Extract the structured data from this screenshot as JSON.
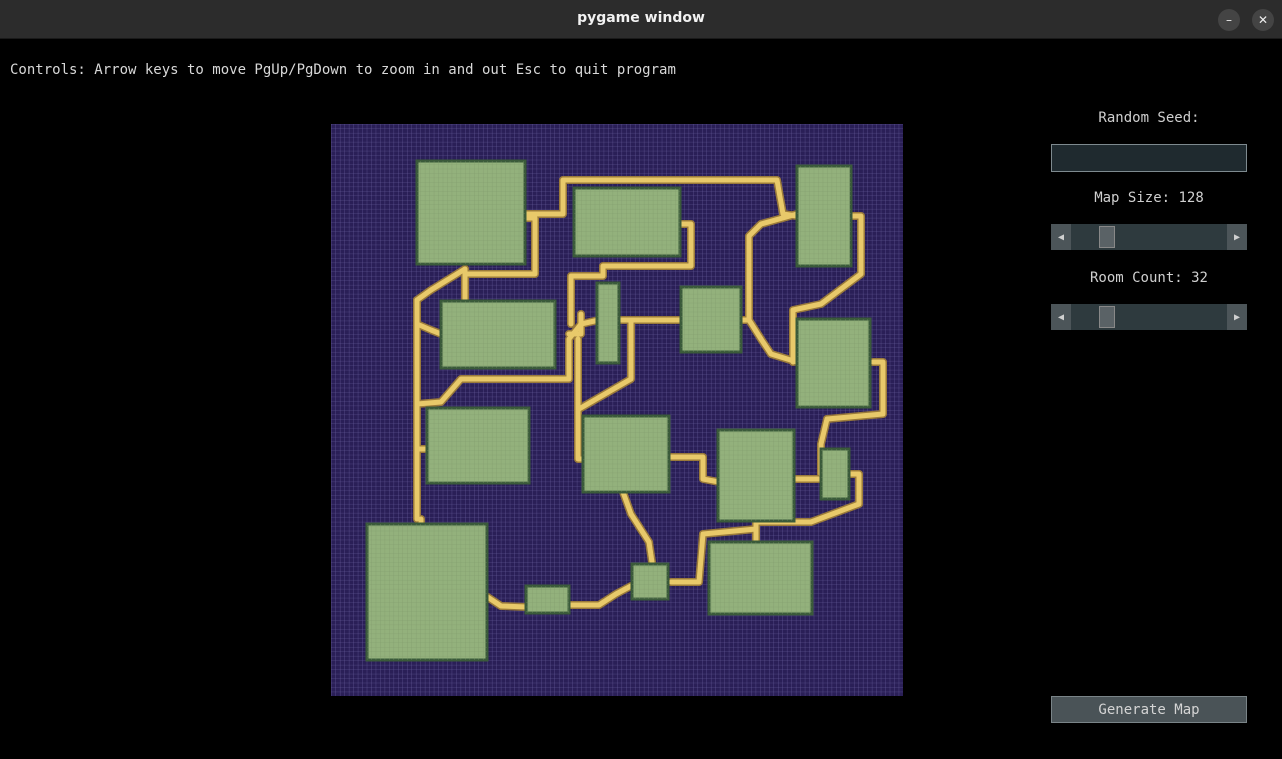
{
  "window": {
    "title": "pygame window",
    "minimize_icon": "minimize-icon",
    "close_icon": "close-icon"
  },
  "controls_text": "Controls: Arrow keys to move PgUp/PgDown to zoom in and out Esc to quit program",
  "map": {
    "grid_size": 128,
    "colors": {
      "background": "#2a1f57",
      "grid": "#6c62a0",
      "room": "#93b17c",
      "room_grid": "#7f9a6c",
      "room_border": "#3a5a3a",
      "corridor": "#e8c96a",
      "corridor_edge": "#9a7a3a"
    }
  },
  "panel": {
    "seed_label": "Random Seed:",
    "seed_value": "",
    "map_size_label": "Map Size: 128",
    "map_size_value": 128,
    "room_count_label": "Room Count: 32",
    "room_count_value": 32,
    "arrow_left": "◀",
    "arrow_right": "▶",
    "generate_label": "Generate Map"
  }
}
